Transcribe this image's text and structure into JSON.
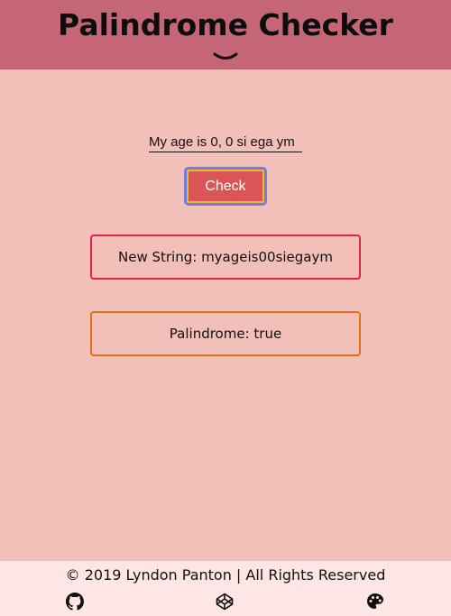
{
  "header": {
    "title": "Palindrome Checker",
    "toggle_icon": "chevron-down-icon"
  },
  "form": {
    "input_value": "My age is 0, 0 si ega ym",
    "button_label": "Check"
  },
  "results": {
    "new_string": "New String: myageis00siegaym",
    "palindrome": "Palindrome: true"
  },
  "footer": {
    "copyright": "© 2019 Lyndon Panton | All Rights Reserved",
    "icons": [
      "github-icon",
      "codepen-icon",
      "palette-icon"
    ]
  },
  "colors": {
    "header_bg": "#c46675",
    "page_bg": "#f2bfb9",
    "button_bg": "#db5556",
    "new_string_border": "#e3223f",
    "palindrome_border": "#e07214",
    "footer_bg": "#fde6e3"
  }
}
